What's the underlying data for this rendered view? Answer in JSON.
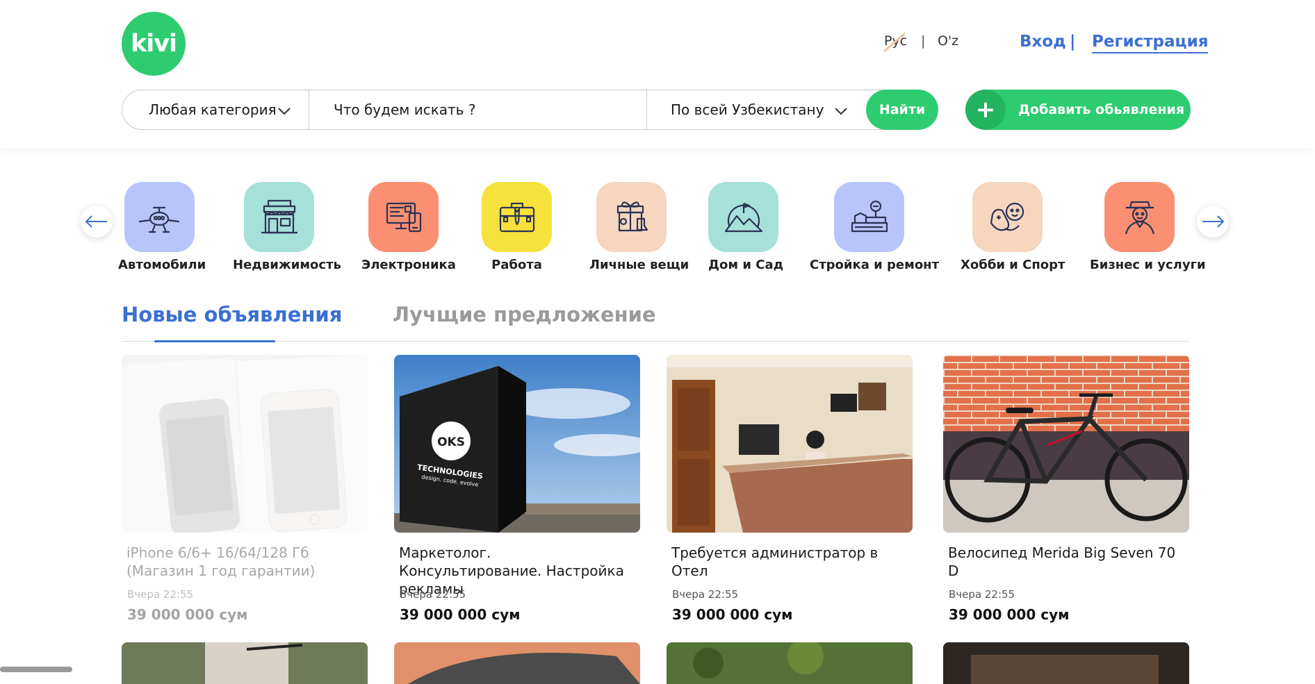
{
  "header": {
    "logo_text": "kivi",
    "lang_ru": "Рус",
    "lang_sep": "|",
    "lang_uz": "O'z",
    "login": "Вход",
    "auth_sep": "|",
    "register": "Регистрация"
  },
  "search": {
    "category": "Любая категория",
    "placeholder": "Что будем искать ?",
    "region": "По всей Узбекистану",
    "find_button": "Найти",
    "add_button": "Добавить обьявления",
    "add_icon": "+"
  },
  "categories": [
    {
      "label": "Автомобили",
      "icon": "airplane-icon",
      "color": "#b7c5fb"
    },
    {
      "label": "Недвижимость",
      "icon": "shop-icon",
      "color": "#a5e0d9"
    },
    {
      "label": "Электроника",
      "icon": "computer-icon",
      "color": "#fb8f72"
    },
    {
      "label": "Работа",
      "icon": "briefcase-icon",
      "color": "#f7e13c"
    },
    {
      "label": "Личные вещи",
      "icon": "gift-icon",
      "color": "#f6d6bf"
    },
    {
      "label": "Дом и Сад",
      "icon": "mountain-icon",
      "color": "#a5e0d9"
    },
    {
      "label": "Стройка и ремонт",
      "icon": "construction-icon",
      "color": "#b7c5fb"
    },
    {
      "label": "Хобби и Спорт",
      "icon": "gamepad-icon",
      "color": "#f6d6bf"
    },
    {
      "label": "Бизнес и услуги",
      "icon": "businessman-icon",
      "color": "#fb8f72"
    }
  ],
  "tabs": {
    "new": "Новые объявления",
    "best": "Лучщие предложение"
  },
  "listings": [
    {
      "title": "iPhone 6/6+ 16/64/128 Гб (Магазин 1 год гарантии)",
      "time": "Вчера 22:55",
      "price": "39 000 000 сум"
    },
    {
      "title": "Маркетолог. Консультирование. Настройка рекламы",
      "time": "Вчера 22:55",
      "price": "39 000 000 сум"
    },
    {
      "title": "Требуется администратор в Отел",
      "time": "Вчера 22:55",
      "price": "39 000 000 сум"
    },
    {
      "title": "Велосипед Merida Big Seven 70 D",
      "time": "Вчера 22:55",
      "price": "39 000 000 сум"
    }
  ],
  "sign": {
    "line1": "OKS",
    "line2": "TECHNOLOGIES",
    "line3": "design. code. evolve"
  },
  "colors": {
    "green": "#2ecc71",
    "blue": "#3b6fd1",
    "gray_tab": "#9a9a9a"
  }
}
